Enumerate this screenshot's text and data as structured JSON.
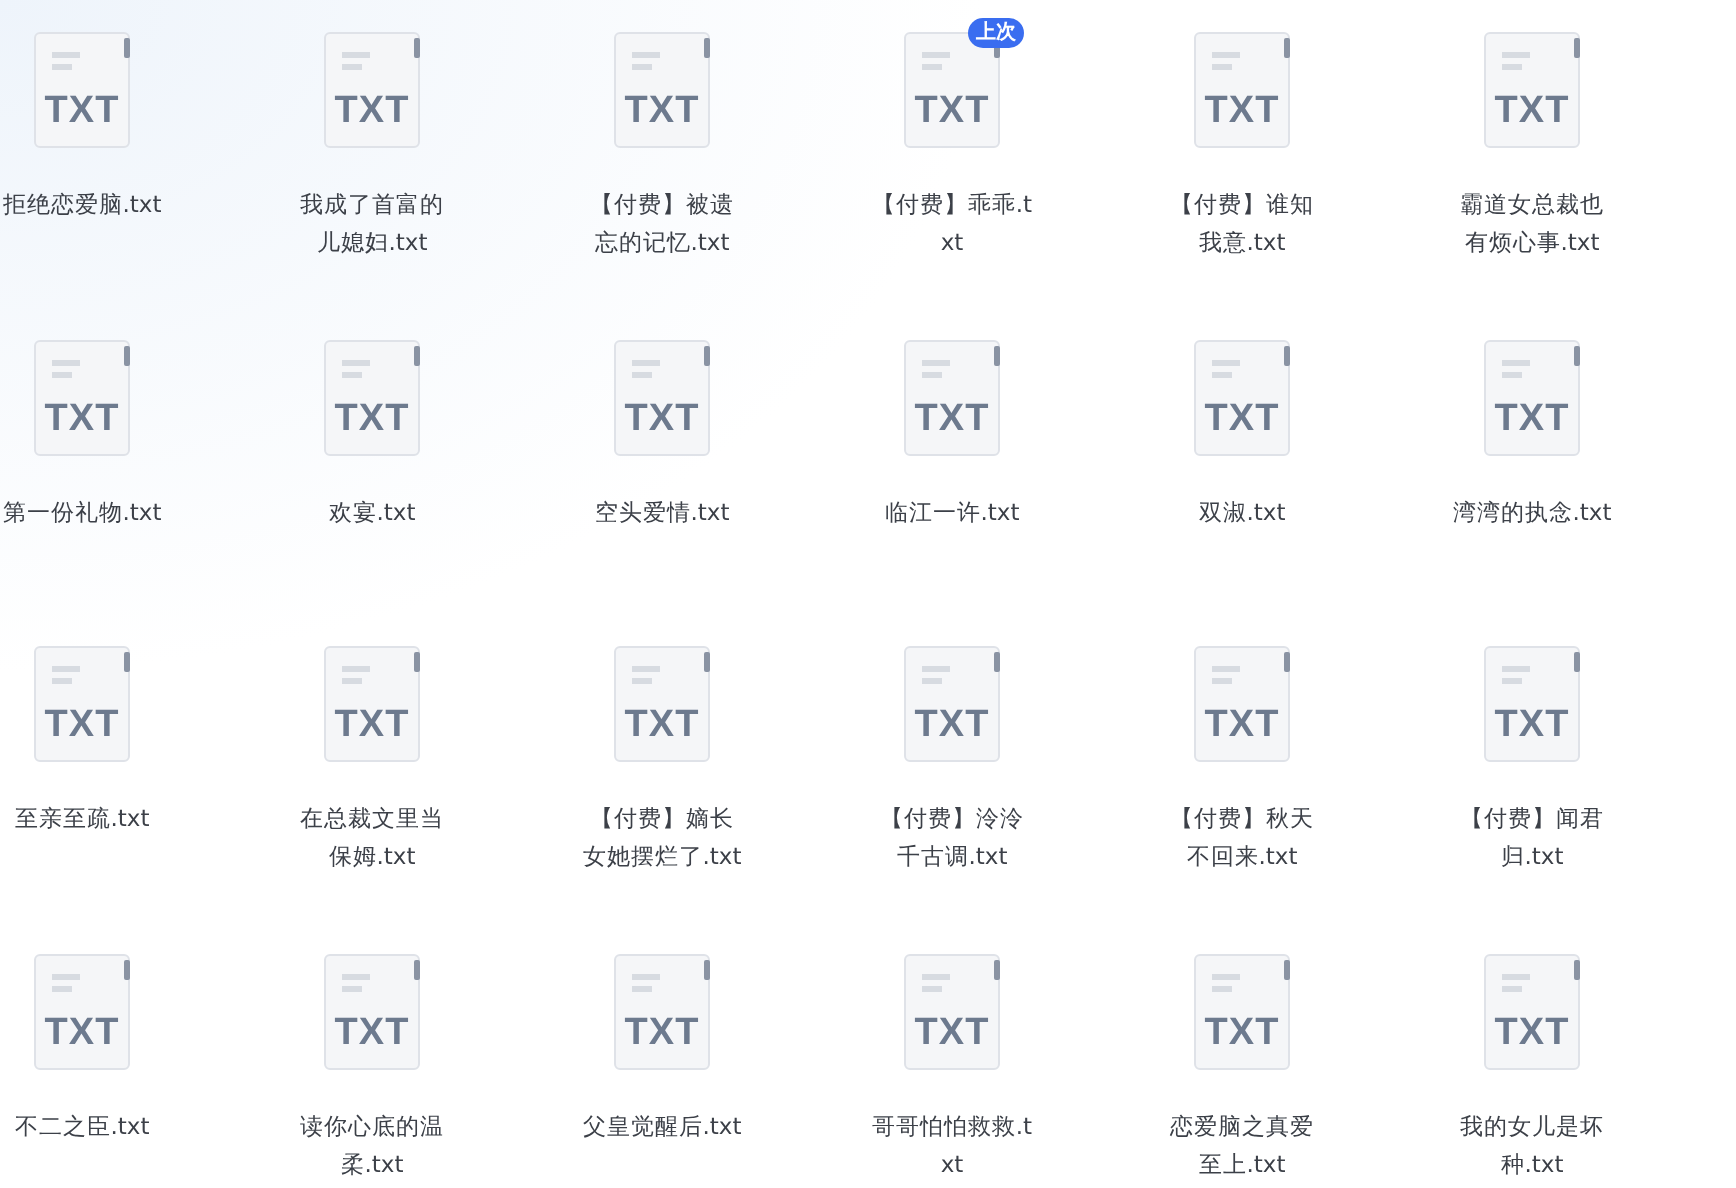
{
  "files": [
    {
      "type_label": "TXT",
      "name_lines": [
        "拒绝恋爱脑.txt"
      ]
    },
    {
      "type_label": "TXT",
      "name_lines": [
        "我成了首富的",
        "儿媳妇.txt"
      ]
    },
    {
      "type_label": "TXT",
      "name_lines": [
        "【付费】被遗",
        "忘的记忆.txt"
      ]
    },
    {
      "type_label": "TXT",
      "name_lines": [
        "【付费】乖乖.t",
        "xt"
      ],
      "badge": "上次"
    },
    {
      "type_label": "TXT",
      "name_lines": [
        "【付费】谁知",
        "我意.txt"
      ]
    },
    {
      "type_label": "TXT",
      "name_lines": [
        "霸道女总裁也",
        "有烦心事.txt"
      ]
    },
    {
      "type_label": "TXT",
      "name_lines": [
        "第一份礼物.txt"
      ]
    },
    {
      "type_label": "TXT",
      "name_lines": [
        "欢宴.txt"
      ]
    },
    {
      "type_label": "TXT",
      "name_lines": [
        "空头爱情.txt"
      ]
    },
    {
      "type_label": "TXT",
      "name_lines": [
        "临江一许.txt"
      ]
    },
    {
      "type_label": "TXT",
      "name_lines": [
        "双淑.txt"
      ]
    },
    {
      "type_label": "TXT",
      "name_lines": [
        "湾湾的执念.txt"
      ]
    },
    {
      "type_label": "TXT",
      "name_lines": [
        "至亲至疏.txt"
      ]
    },
    {
      "type_label": "TXT",
      "name_lines": [
        "在总裁文里当",
        "保姆.txt"
      ]
    },
    {
      "type_label": "TXT",
      "name_lines": [
        "【付费】嫡长",
        "女她摆烂了.txt"
      ]
    },
    {
      "type_label": "TXT",
      "name_lines": [
        "【付费】泠泠",
        "千古调.txt"
      ]
    },
    {
      "type_label": "TXT",
      "name_lines": [
        "【付费】秋天",
        "不回来.txt"
      ]
    },
    {
      "type_label": "TXT",
      "name_lines": [
        "【付费】闻君",
        "归.txt"
      ]
    },
    {
      "type_label": "TXT",
      "name_lines": [
        "不二之臣.txt"
      ]
    },
    {
      "type_label": "TXT",
      "name_lines": [
        "读你心底的温",
        "柔.txt"
      ]
    },
    {
      "type_label": "TXT",
      "name_lines": [
        "父皇觉醒后.txt"
      ]
    },
    {
      "type_label": "TXT",
      "name_lines": [
        "哥哥怕怕救救.t",
        "xt"
      ]
    },
    {
      "type_label": "TXT",
      "name_lines": [
        "恋爱脑之真爱",
        "至上.txt"
      ]
    },
    {
      "type_label": "TXT",
      "name_lines": [
        "我的女儿是坏",
        "种.txt"
      ]
    }
  ]
}
